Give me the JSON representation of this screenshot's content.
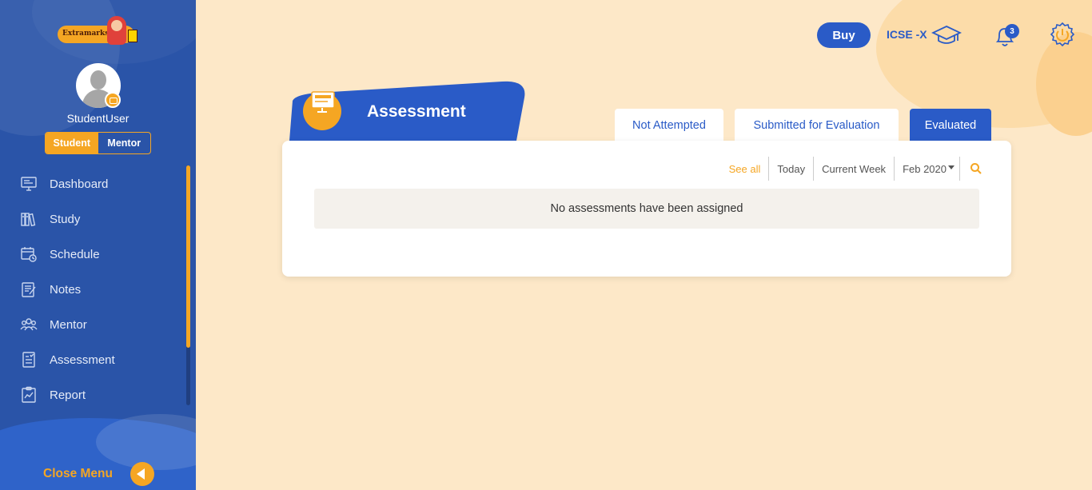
{
  "sidebar": {
    "logo_text": "Extramarks",
    "username": "StudentUser",
    "roles": [
      "Student",
      "Mentor"
    ],
    "active_role": "Student",
    "items": [
      {
        "label": "Dashboard",
        "icon": "dashboard-icon"
      },
      {
        "label": "Study",
        "icon": "books-icon"
      },
      {
        "label": "Schedule",
        "icon": "calendar-clock-icon"
      },
      {
        "label": "Notes",
        "icon": "notes-icon"
      },
      {
        "label": "Mentor",
        "icon": "group-icon"
      },
      {
        "label": "Assessment",
        "icon": "assessment-icon"
      },
      {
        "label": "Report",
        "icon": "report-icon"
      }
    ],
    "close_menu": "Close Menu"
  },
  "header": {
    "buy": "Buy",
    "grade": "ICSE -X",
    "notification_count": "3"
  },
  "assessment": {
    "title": "Assessment",
    "tabs": [
      "Not Attempted",
      "Submitted for Evaluation",
      "Evaluated"
    ],
    "active_tab": "Evaluated",
    "filters": {
      "see_all": "See all",
      "today": "Today",
      "current_week": "Current Week",
      "month": "Feb 2020"
    },
    "empty_message": "No assessments have been assigned"
  },
  "colors": {
    "primary_blue": "#2a5bc7",
    "accent_orange": "#f5a623",
    "page_bg": "#fde8c8"
  }
}
